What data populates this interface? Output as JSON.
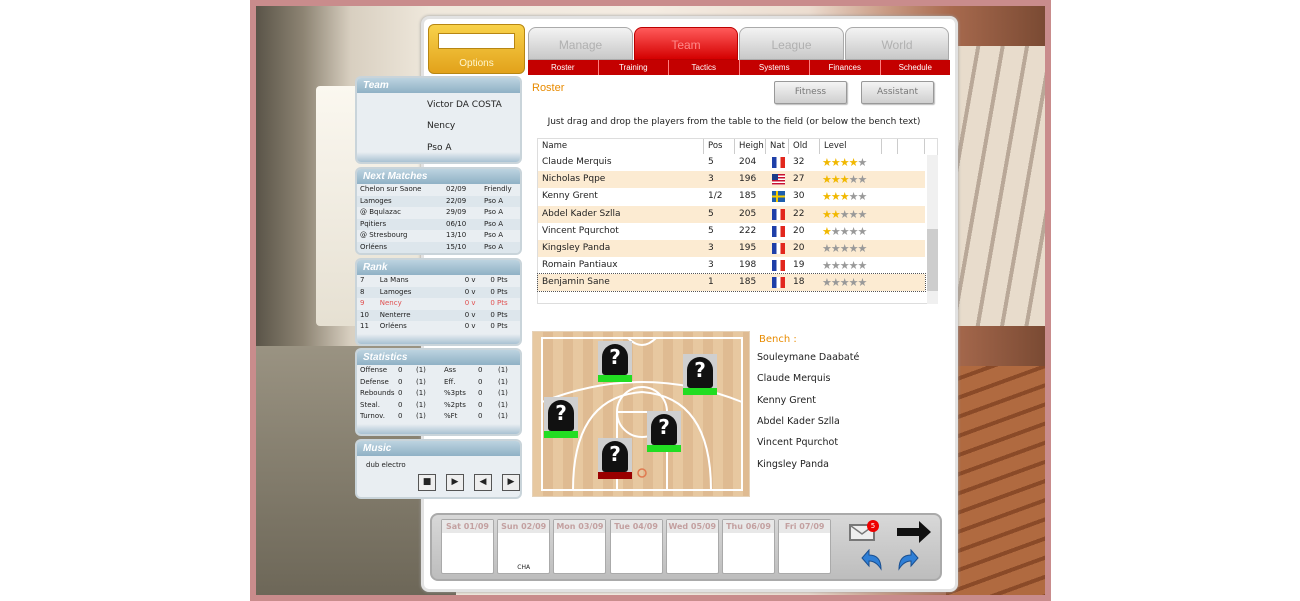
{
  "options": {
    "label": "Options"
  },
  "tabs": [
    {
      "label": "Manage"
    },
    {
      "label": "Team"
    },
    {
      "label": "League"
    },
    {
      "label": "World"
    }
  ],
  "subnav": [
    "Roster",
    "Training",
    "Tactics",
    "Systems",
    "Finances",
    "Schedule"
  ],
  "team_panel": {
    "title": "Team",
    "coach": "Victor DA COSTA",
    "club": "Nency",
    "league": "Pso A"
  },
  "next_matches": {
    "title": "Next Matches",
    "rows": [
      {
        "team": "Chelon sur Saone",
        "date": "02/09",
        "comp": "Friendly"
      },
      {
        "team": "Lamoges",
        "date": "22/09",
        "comp": "Pso A"
      },
      {
        "team": "@ Bqulazac",
        "date": "29/09",
        "comp": "Pso A"
      },
      {
        "team": "Pqitiers",
        "date": "06/10",
        "comp": "Pso A"
      },
      {
        "team": "@ Stresbourg",
        "date": "13/10",
        "comp": "Pso A"
      },
      {
        "team": "Orléens",
        "date": "15/10",
        "comp": "Pso A"
      }
    ]
  },
  "rank": {
    "title": "Rank",
    "rows": [
      {
        "pos": "7",
        "team": "La Mans",
        "v": "0 v",
        "pts": "0 Pts"
      },
      {
        "pos": "8",
        "team": "Lamoges",
        "v": "0 v",
        "pts": "0 Pts"
      },
      {
        "pos": "9",
        "team": "Nency",
        "v": "0 v",
        "pts": "0 Pts"
      },
      {
        "pos": "10",
        "team": "Nenterre",
        "v": "0 v",
        "pts": "0 Pts"
      },
      {
        "pos": "11",
        "team": "Orléens",
        "v": "0 v",
        "pts": "0 Pts"
      }
    ]
  },
  "statistics": {
    "title": "Statistics",
    "rows": [
      {
        "a": "Offense",
        "av": "0",
        "ar": "(1)",
        "b": "Ass",
        "bv": "0",
        "br": "(1)"
      },
      {
        "a": "Defense",
        "av": "0",
        "ar": "(1)",
        "b": "Eff.",
        "bv": "0",
        "br": "(1)"
      },
      {
        "a": "Rebounds",
        "av": "0",
        "ar": "(1)",
        "b": "%3pts",
        "bv": "0",
        "br": "(1)"
      },
      {
        "a": "Steal.",
        "av": "0",
        "ar": "(1)",
        "b": "%2pts",
        "bv": "0",
        "br": "(1)"
      },
      {
        "a": "Turnov.",
        "av": "0",
        "ar": "(1)",
        "b": "%Ft",
        "bv": "0",
        "br": "(1)"
      }
    ]
  },
  "music": {
    "title": "Music",
    "track": "dub electro"
  },
  "roster": {
    "title": "Roster",
    "fitness": "Fitness",
    "assistant": "Assistant",
    "instructions": "Just drag and drop the players from the table to the field (or below the bench text)",
    "columns": [
      "Name",
      "Pos",
      "Heigh",
      "Nat",
      "Old",
      "Level"
    ],
    "players": [
      {
        "name": "Claude Merquis",
        "pos": "5",
        "height": "204",
        "nat": "fr",
        "old": "32",
        "level": 4
      },
      {
        "name": "Nicholas Pqpe",
        "pos": "3",
        "height": "196",
        "nat": "us",
        "old": "27",
        "level": 3
      },
      {
        "name": "Kenny Grent",
        "pos": "1/2",
        "height": "185",
        "nat": "se",
        "old": "30",
        "level": 3
      },
      {
        "name": "Abdel Kader Szlla",
        "pos": "5",
        "height": "205",
        "nat": "fr",
        "old": "22",
        "level": 2
      },
      {
        "name": "Vincent Pqurchot",
        "pos": "5",
        "height": "222",
        "nat": "fr",
        "old": "20",
        "level": 1
      },
      {
        "name": "Kingsley Panda",
        "pos": "3",
        "height": "195",
        "nat": "fr",
        "old": "20",
        "level": 0
      },
      {
        "name": "Romain Pantiaux",
        "pos": "3",
        "height": "198",
        "nat": "fr",
        "old": "19",
        "level": 0
      },
      {
        "name": "Benjamin Sane",
        "pos": "1",
        "height": "185",
        "nat": "fr",
        "old": "18",
        "level": 0
      }
    ]
  },
  "bench": {
    "title": "Bench :",
    "players": [
      "Souleymane Daabaté",
      "Claude Merquis",
      "Kenny Grent",
      "Abdel Kader Szlla",
      "Vincent Pqurchot",
      "Kingsley Panda"
    ]
  },
  "calendar": [
    {
      "day": "Sat 01/09",
      "event": ""
    },
    {
      "day": "Sun 02/09",
      "event": "CHA"
    },
    {
      "day": "Mon 03/09",
      "event": ""
    },
    {
      "day": "Tue 04/09",
      "event": ""
    },
    {
      "day": "Wed 05/09",
      "event": ""
    },
    {
      "day": "Thu 06/09",
      "event": ""
    },
    {
      "day": "Fri 07/09",
      "event": ""
    }
  ],
  "mail": {
    "count": "5"
  },
  "colors": {
    "accent": "#d40000",
    "orange": "#e88b00",
    "rank_highlight": "#e05050"
  }
}
